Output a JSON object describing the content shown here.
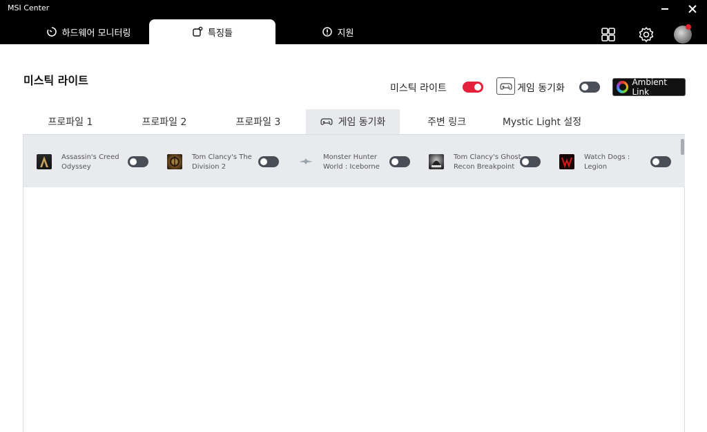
{
  "app": {
    "title": "MSI Center"
  },
  "top_tabs": [
    {
      "label": "하드웨어 모니터링",
      "active": false
    },
    {
      "label": "특징들",
      "active": true
    },
    {
      "label": "지원",
      "active": false
    }
  ],
  "header": {
    "title": "미스틱 라이트",
    "mystic_light_label": "미스틱 라이트",
    "mystic_light_on": true,
    "game_sync_label": "게임 동기화",
    "game_sync_on": false,
    "ambient_link_label": "Ambient Link"
  },
  "sub_tabs": [
    {
      "label": "프로파일 1",
      "active": false
    },
    {
      "label": "프로파일 2",
      "active": false
    },
    {
      "label": "프로파일 3",
      "active": false
    },
    {
      "label": "게임 동기화",
      "active": true
    },
    {
      "label": "주변 링크",
      "active": false
    },
    {
      "label": "Mystic Light 설정",
      "active": false
    }
  ],
  "games": [
    {
      "name": "Assassin's Creed Odyssey",
      "enabled": false
    },
    {
      "name": "Tom Clancy's The Division 2",
      "enabled": false
    },
    {
      "name": "Monster Hunter World : Iceborne",
      "enabled": false
    },
    {
      "name": "Tom Clancy's Ghost Recon Breakpoint",
      "enabled": false
    },
    {
      "name": "Watch Dogs : Legion",
      "enabled": false
    }
  ],
  "colors": {
    "accent_red": "#e4203a",
    "titlebar": "#000000",
    "panel": "#e8eaee"
  }
}
